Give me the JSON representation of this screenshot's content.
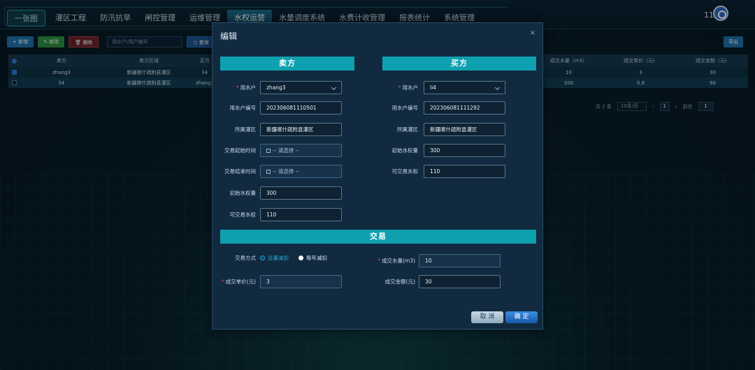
{
  "nav": {
    "home": "一张图",
    "items": [
      "灌区工程",
      "防汛抗旱",
      "闸控管理",
      "运维管理",
      "水权运营",
      "水量调度系统",
      "水费计收管理",
      "报表统计",
      "系统管理"
    ],
    "active_index": 4,
    "user": "111"
  },
  "toolbar": {
    "add": "+ 新增",
    "edit": "✎ 修改",
    "del": "🗑 删除",
    "search_placeholder": "用水户/用户编号",
    "query": "○ 查询",
    "export": "导出"
  },
  "table": {
    "headers": [
      "卖方",
      "卖方区域",
      "买方"
    ],
    "right_headers": [
      "成交水量（m3）",
      "成交单价（元）",
      "成交金额（元）"
    ],
    "rows": [
      {
        "seller": "zhang3",
        "area": "新疆喀什疏附县灌区",
        "buyer": "li4",
        "qty": "10",
        "price": "3",
        "amount": "30",
        "checked": true
      },
      {
        "seller": "li4",
        "area": "新疆喀什疏附县灌区",
        "buyer": "zhang3",
        "qty": "100",
        "price": "0.9",
        "amount": "90",
        "checked": false
      }
    ]
  },
  "pager": {
    "total": "共 2 条",
    "size": "10条/页",
    "prev": "‹",
    "page": "1",
    "next": "›",
    "goto": "前往",
    "goto_page": "1"
  },
  "modal": {
    "title": "编辑",
    "close": "×",
    "seller_title": "卖方",
    "buyer_title": "买方",
    "trade_title": "交易",
    "seller": {
      "user_label": "用水户",
      "user_value": "zhang3",
      "code_label": "用水户编号",
      "code_value": "202306081110501",
      "area_label": "所属灌区",
      "area_value": "新疆喀什疏附县灌区",
      "start_label": "交易起始时间",
      "start_placeholder": "-- 请选择 --",
      "end_label": "交易结束时间",
      "end_placeholder": "-- 请选择 --",
      "init_label": "初始水权量",
      "init_value": "300",
      "trade_label": "可交易水权",
      "trade_value": "110"
    },
    "buyer": {
      "user_label": "用水户",
      "user_value": "li4",
      "code_label": "用水户编号",
      "code_value": "202306081111292",
      "area_label": "所属灌区",
      "area_value": "新疆喀什疏附县灌区",
      "init_label": "初始水权量",
      "init_value": "300",
      "trade_label": "可交易水权",
      "trade_value": "110"
    },
    "trade": {
      "mode_label": "交易方式",
      "mode_opt1": "总量减扣",
      "mode_opt2": "每年减扣",
      "qty_label": "成交水量(m3)",
      "qty_value": "10",
      "price_label": "成交单价(元)",
      "price_value": "3",
      "amount_label": "成交金额(元)",
      "amount_value": "30"
    },
    "cancel": "取 消",
    "ok": "确 定"
  }
}
